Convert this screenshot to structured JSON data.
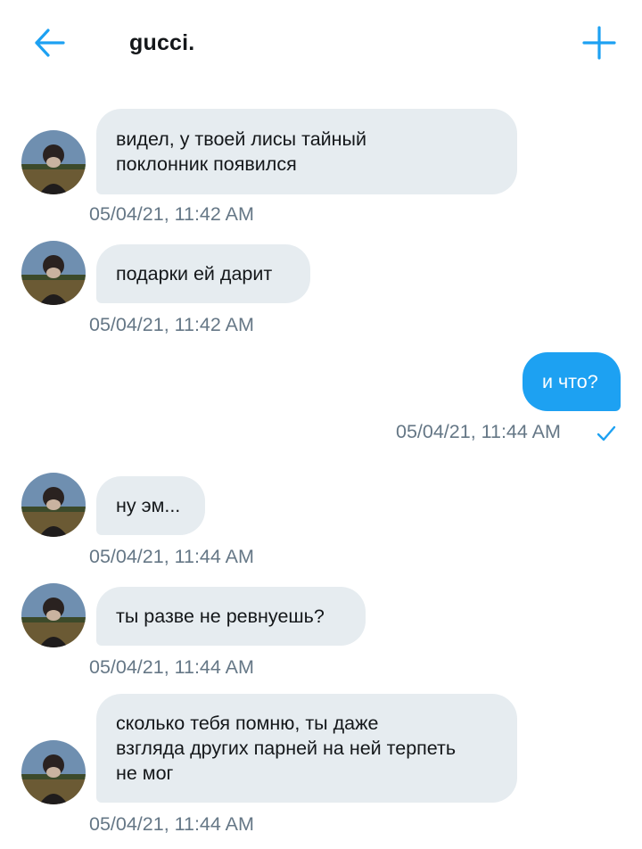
{
  "header": {
    "back_icon": "arrow-left-icon",
    "title": "gucci.",
    "add_icon": "plus-icon",
    "accent": "#1da1f2"
  },
  "messages": [
    {
      "direction": "in",
      "text": "видел, у твоей лисы тайный\nпоклонник появился",
      "time": "05/04/21, 11:42 AM"
    },
    {
      "direction": "in",
      "text": "подарки ей дарит",
      "time": "05/04/21, 11:42 AM"
    },
    {
      "direction": "out",
      "text": "и что?",
      "time": "05/04/21, 11:44 AM",
      "status_icon": "check-icon"
    },
    {
      "direction": "in",
      "text": "ну эм...",
      "time": "05/04/21, 11:44 AM"
    },
    {
      "direction": "in",
      "text": "ты разве не ревнуешь?",
      "time": "05/04/21, 11:44 AM"
    },
    {
      "direction": "in",
      "text": "сколько тебя помню, ты даже\nвзгляда других парней на ней терпеть\nне мог",
      "time": "05/04/21, 11:44 AM"
    }
  ],
  "colors": {
    "incoming_bubble": "#e6ecf0",
    "outgoing_bubble": "#1da1f2",
    "timestamp": "#657786"
  }
}
